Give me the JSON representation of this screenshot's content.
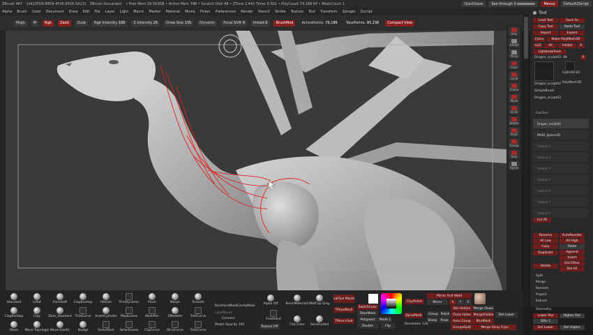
{
  "title_bar": {
    "app": "ZBrush 4R7",
    "build": "[d422FD9-8858-4F26-9505-5A13]",
    "document": "ZBrush Document",
    "stats": "• Free Mem 29.563GB • Active Mem 798 • Scratch Disk 48 • ZTime 2.442 Timer 0.001 • PolyCount 79.188 KP • MeshCount 1",
    "quicksave": "QuickSave",
    "see_through": "See-through  0",
    "menus": "Menus",
    "default_zscript": "DefaultZScript"
  },
  "menubar": [
    "Alpha",
    "Brush",
    "Color",
    "Document",
    "Draw",
    "Edit",
    "File",
    "Layer",
    "Light",
    "Macro",
    "Marker",
    "Material",
    "Movie",
    "Picker",
    "Preferences",
    "Render",
    "Stencil",
    "Stroke",
    "Texture",
    "Tool",
    "Transform",
    "Zplugin",
    "Zscript"
  ],
  "topbar": {
    "mrgb": "Mrgb",
    "m": "M",
    "rgb": "Rgb",
    "zadd": "Zadd",
    "zsub": "Zsub",
    "rgb_intensity_label": "Rgb Intensity",
    "rgb_intensity": "100",
    "z_intensity_label": "Z Intensity",
    "z_intensity": "25",
    "draw_size_label": "Draw Size",
    "draw_size": "135",
    "dynamic": "Dynamic",
    "focal_shift_label": "Focal Shift",
    "focal_shift": "0",
    "imbed_label": "Imbed",
    "imbed": "0",
    "brushmod": "BrushMod",
    "active_points_label": "ActivePoints:",
    "active_points": "79,186",
    "total_points_label": "TotalPoints:",
    "total_points": "95,238",
    "compact_view": "Compact View"
  },
  "vtools": [
    "Sdiv",
    "AAHalf",
    "Persp",
    "Floor",
    "Local",
    "Frame",
    "Move",
    "Scale",
    "Rotate",
    "PolyF",
    "Transp",
    "Solo",
    "Xpose"
  ],
  "right_panel": {
    "title": "Tool",
    "load_tool": "Load Tool",
    "save_as": "Save As",
    "copy_tool": "Copy Tool",
    "paste_tool": "Paste Tool",
    "import": "Import",
    "export": "Export",
    "clone": "Clone",
    "make_polymesh": "Make PolyMesh3D",
    "goz": "GoZ",
    "all": "All",
    "visible": "Visible",
    "r": "R",
    "lightbox_tools": "Lightbox▸Tools",
    "current_tool": "Dragon_sculpt02: 48",
    "r2": "R",
    "tool_names": [
      "Dragon_sculpt02",
      "Cylinder3D",
      "SimpleBrush",
      "PolyMesh3D",
      "Dragon_sculpt02"
    ],
    "subtool": "SubTool",
    "subtool_items": [
      "Dragon_sculpt02",
      "PM3D_Sphere3D"
    ],
    "subtool_empty": [
      "Subtool 2",
      "Subtool 3",
      "Subtool 4",
      "Subtool 5",
      "Subtool 6",
      "Subtool 7",
      "Subtool 8"
    ],
    "list_all": "List All",
    "rename": "Rename",
    "autoreorder": "AutoReorder",
    "all_low": "All Low",
    "all_high": "All High",
    "copy": "Copy",
    "paste": "Paste",
    "duplicate": "Duplicate",
    "append": "Append",
    "insert": "Insert",
    "delete": "Delete",
    "del_other": "Del Other",
    "del_all": "Del All",
    "split": "Split",
    "merge": "Merge",
    "remesh": "Remesh",
    "project": "Project",
    "extract": "Extract",
    "geometry": "Geometry",
    "lower_res": "Lower Res",
    "higher_res": "Higher Res",
    "sdiv": "SDiv 1",
    "del_lower": "Del Lower",
    "del_higher": "Del Higher"
  },
  "brushes": [
    [
      "Standard",
      "Inflat",
      "FormSoft",
      "ClayBuildup",
      "hPolish",
      "TrimDynamic",
      "Pinch",
      "Morph",
      "Smooth"
    ],
    [
      "ClayBuildup",
      "Clay",
      "Dam_Standard",
      "TrimCurve",
      "InsertCylinder",
      "MaskLasso",
      "MaskPen",
      "ZModeler",
      "TrimCurve"
    ],
    [
      "Move",
      "Move Topologic",
      "Move Elastic",
      "Nudge",
      "SelectRect",
      "SelectLasso",
      "ClipCurve",
      "SliceCurve",
      "TrimCurve"
    ]
  ],
  "bottom": {
    "backface_mask": "BackfaceMask",
    "cavity_mask": "CavityMask",
    "lazymouse": "LazyMouse",
    "connect": "Connect",
    "model_opacity_label": "Model Opacity",
    "model_opacity": "100",
    "texture_off": "Texture Off",
    "alpha_off": "Alpha Off",
    "freehand": "FreeHand",
    "flat_color": "Flat Color",
    "skin_shade4": "SkinShade4",
    "basic_material2": "BasicMaterial2",
    "matcap_gray": "MatCap Gray",
    "subtool_master": "SubTool Master",
    "tposemesh": "TPoseMesh",
    "tposesub": "TPose>Sub",
    "switch_color": "SwitchColor",
    "fibermesh": "FiberMesh",
    "polypaint": "Polypaint",
    "double": "Double",
    "clay_polish": "ClayPolish",
    "dynamesh": "DynaMesh",
    "mode1": "Mode 1",
    "flip": "Flip",
    "resolution_label": "Resolution",
    "resolution": "128",
    "mirror_and_weld": "Mirror And Weld",
    "mirror": "Mirror",
    "mirror_x": "X",
    "mirror_y": "Y",
    "mirror_z": "Z",
    "del_hidden": "Del Hidden",
    "close_holes": "Close Holes",
    "group": "Group",
    "polish": "Polish",
    "auto_group": "Auto Group",
    "blur_mask": "BlurMask",
    "groups_split": "GroupsSplit",
    "merge_down": "Merge Down",
    "merge_visible": "MergeVisible",
    "del_lower": "Del Lower",
    "sharp": "Sharp",
    "proje": "Proje",
    "merge_stray_grps": "Merge Stray Grps"
  },
  "colors": {
    "accent_red": "#8a1f1f",
    "viewport_bg": "#3a3a3a",
    "panel_bg": "#282828",
    "curve_red": "#e02020"
  }
}
